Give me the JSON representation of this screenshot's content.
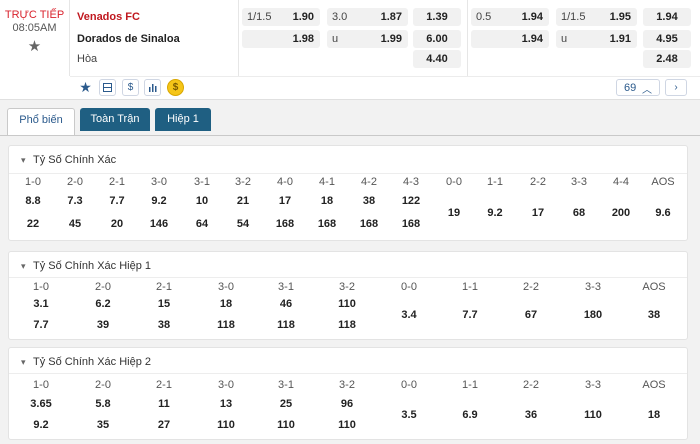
{
  "match": {
    "live_label": "TRỰC TIẾP",
    "time": "08:05AM",
    "home": "Venados FC",
    "away": "Dorados de Sinaloa",
    "draw_label": "Hòa",
    "more_count": "69"
  },
  "odds": {
    "c1": [
      {
        "l": "1/1.5",
        "r": "1.90"
      },
      {
        "l": "",
        "r": "1.98"
      }
    ],
    "c2": [
      {
        "l": "3.0",
        "r": "1.87"
      },
      {
        "l": "u",
        "r": "1.99"
      }
    ],
    "c3": [
      "1.39",
      "6.00",
      "4.40"
    ],
    "c4": [
      {
        "l": "0.5",
        "r": "1.94"
      },
      {
        "l": "",
        "r": "1.94"
      }
    ],
    "c5": [
      {
        "l": "1/1.5",
        "r": "1.95"
      },
      {
        "l": "u",
        "r": "1.91"
      }
    ],
    "c6": [
      "1.94",
      "4.95",
      "2.48"
    ]
  },
  "tabs": [
    "Phổ biến",
    "Toàn Trận",
    "Hiệp 1"
  ],
  "sections": [
    {
      "title": "Tỷ Số Chính Xác",
      "left": {
        "labels": [
          "1-0",
          "2-0",
          "2-1",
          "3-0",
          "3-1",
          "3-2",
          "4-0",
          "4-1",
          "4-2",
          "4-3"
        ],
        "row1": [
          "8.8",
          "7.3",
          "7.7",
          "9.2",
          "10",
          "21",
          "17",
          "18",
          "38",
          "122"
        ],
        "row2": [
          "22",
          "45",
          "20",
          "146",
          "64",
          "54",
          "168",
          "168",
          "168",
          "168"
        ]
      },
      "right": {
        "labels": [
          "0-0",
          "1-1",
          "2-2",
          "3-3",
          "4-4",
          "AOS"
        ],
        "values": [
          "19",
          "9.2",
          "17",
          "68",
          "200",
          "9.6"
        ]
      }
    },
    {
      "title": "Tỷ Số Chính Xác Hiệp 1",
      "left": {
        "labels": [
          "1-0",
          "2-0",
          "2-1",
          "3-0",
          "3-1",
          "3-2"
        ],
        "row1": [
          "3.1",
          "6.2",
          "15",
          "18",
          "46",
          "110"
        ],
        "row2": [
          "7.7",
          "39",
          "38",
          "118",
          "118",
          "118"
        ]
      },
      "right": {
        "labels": [
          "0-0",
          "1-1",
          "2-2",
          "3-3",
          "AOS"
        ],
        "values": [
          "3.4",
          "7.7",
          "67",
          "180",
          "38"
        ]
      }
    },
    {
      "title": "Tỷ Số Chính Xác Hiệp 2",
      "left": {
        "labels": [
          "1-0",
          "2-0",
          "2-1",
          "3-0",
          "3-1",
          "3-2"
        ],
        "row1": [
          "3.65",
          "5.8",
          "11",
          "13",
          "25",
          "96"
        ],
        "row2": [
          "9.2",
          "35",
          "27",
          "110",
          "110",
          "110"
        ]
      },
      "right": {
        "labels": [
          "0-0",
          "1-1",
          "2-2",
          "3-3",
          "AOS"
        ],
        "values": [
          "3.5",
          "6.9",
          "36",
          "110",
          "18"
        ]
      }
    }
  ]
}
